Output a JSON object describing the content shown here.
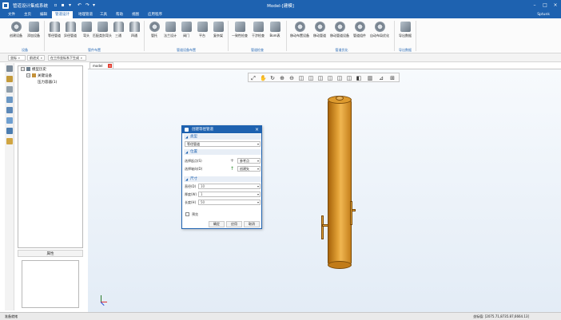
{
  "app": {
    "title": "管道设计集成系统",
    "document_title": "Model-[建模]",
    "user": "Sptunk",
    "accent": "#1e62b0"
  },
  "menu": {
    "tabs": [
      "文件",
      "主页",
      "编辑",
      "管道设计",
      "地理管道",
      "工具",
      "帮助",
      "视图",
      "应用程序"
    ],
    "active": "管道设计"
  },
  "ribbon": {
    "groups": [
      {
        "label": "设备",
        "buttons": [
          "创建设备",
          "添加设备"
        ]
      },
      {
        "label": "管件布置",
        "buttons": [
          "等径管道",
          "异径管道",
          "弯头",
          "匹配类别弯头",
          "三通",
          "四通"
        ]
      },
      {
        "label": "管道设备布置",
        "buttons": [
          "管托",
          "法兰设计",
          "阀门",
          "平台",
          "复杂架"
        ]
      },
      {
        "label": "管道检查",
        "buttons": [
          "一致性检查",
          "干涉检查",
          "Bom表"
        ]
      },
      {
        "label": "管道优化",
        "buttons": [
          "移动布置设备",
          "移动管道",
          "移动管道设备",
          "管道组件",
          "自动布局优化"
        ]
      },
      {
        "label": "导出数据",
        "buttons": [
          "导出数据"
        ]
      }
    ]
  },
  "toolbar2": {
    "items": [
      "坐标",
      "前进式",
      "在工作坐标系下生成"
    ]
  },
  "tree": {
    "root": "模型历史",
    "child": "关键设备",
    "leaf": "压力容器(1)",
    "caption": "属性"
  },
  "viewport": {
    "tab_label": "model",
    "tools": [
      "zoom-fit-icon",
      "pan-icon",
      "rotate-icon",
      "zoom-in-icon",
      "zoom-out-icon",
      "view-front-icon",
      "view-back-icon",
      "view-left-icon",
      "view-right-icon",
      "view-top-icon",
      "view-bottom-icon",
      "view-iso-icon",
      "section-icon",
      "measure-icon",
      "explode-icon"
    ]
  },
  "dialog": {
    "title": "创建等径管道",
    "type_section": "类型",
    "type_value": "等径管道",
    "placement_section": "位置",
    "start_label": "选择起点(S)",
    "start_ref": "参考点",
    "axis_label": "选择轴向(D)",
    "axis_ref": "创建矢",
    "size_section": "尺寸",
    "fields": [
      {
        "label": "直径(D)",
        "value": "10"
      },
      {
        "label": "厚度(W)",
        "value": "1"
      },
      {
        "label": "长度(H)",
        "value": "50"
      }
    ],
    "preview_label": "预览",
    "ok": "确定",
    "apply": "应用",
    "cancel": "取消"
  },
  "status": {
    "left": "准备就绪",
    "right": "坐标值: [2075.71,8735.87,6664.13]"
  }
}
